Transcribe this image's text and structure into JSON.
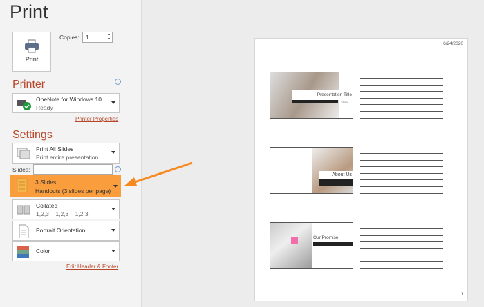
{
  "title": "Print",
  "print_button": "Print",
  "copies": {
    "label": "Copies:",
    "value": "1"
  },
  "printer": {
    "heading": "Printer",
    "name": "OneNote for Windows 10",
    "status": "Ready",
    "properties_link": "Printer Properties"
  },
  "settings": {
    "heading": "Settings",
    "range": {
      "title": "Print All Slides",
      "sub": "Print entire presentation"
    },
    "slides_label": "Slides:",
    "slides_value": "",
    "layout": {
      "title": "3 Slides",
      "sub": "Handouts (3 slides per page)"
    },
    "collation": {
      "title": "Collated",
      "sub": "1,2,3    1,2,3    1,2,3"
    },
    "orientation": "Portrait Orientation",
    "color": "Color",
    "header_footer_link": "Edit Header & Footer"
  },
  "preview": {
    "date": "6/24/2020",
    "page_number": "1",
    "slides": [
      {
        "title": "Presentation Title",
        "tag": "TREY"
      },
      {
        "title": "About Us"
      },
      {
        "title": "Our Promise"
      }
    ]
  },
  "colors": {
    "accent": "#b7472a",
    "highlight": "#fa9d3c",
    "arrow": "#f7891f"
  }
}
